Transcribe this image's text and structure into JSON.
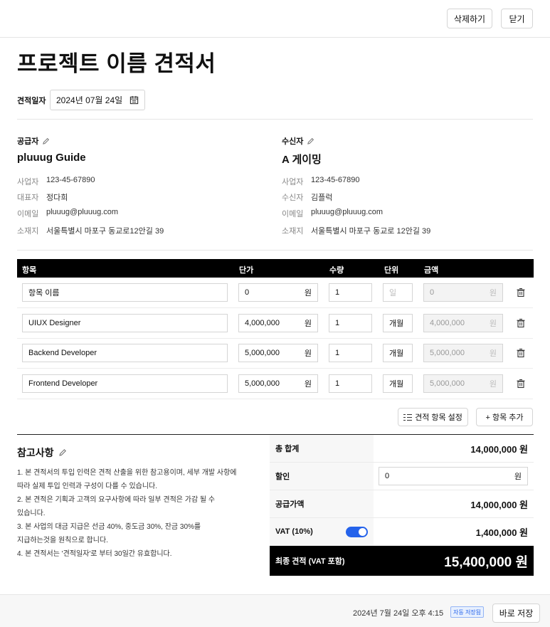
{
  "header": {
    "delete_label": "삭제하기",
    "close_label": "닫기"
  },
  "title": "프로젝트 이름 견적서",
  "date": {
    "label": "견적일자",
    "value": "2024년 07월 24일"
  },
  "supplier": {
    "heading": "공급자",
    "name": "pluuug Guide",
    "fields": [
      {
        "label": "사업자",
        "value": "123-45-67890"
      },
      {
        "label": "대표자",
        "value": "정다희"
      },
      {
        "label": "이메일",
        "value": "pluuug@pluuug.com"
      },
      {
        "label": "소재지",
        "value": "서울특별시 마포구 동교로12안길 39"
      }
    ]
  },
  "recipient": {
    "heading": "수신자",
    "name": "A 게이밍",
    "fields": [
      {
        "label": "사업자",
        "value": "123-45-67890"
      },
      {
        "label": "수신자",
        "value": "김플럭"
      },
      {
        "label": "이메일",
        "value": "pluuug@pluuug.com"
      },
      {
        "label": "소재지",
        "value": "서울특별시 마포구 동교로 12안길 39"
      }
    ]
  },
  "table": {
    "headers": {
      "item": "항목",
      "price": "단가",
      "qty": "수량",
      "unit": "단위",
      "amount": "금액"
    },
    "currency": "원",
    "rows": [
      {
        "item": "항목 이름",
        "price": "0",
        "qty": "1",
        "unit": "일",
        "amount": "0",
        "placeholder": true
      },
      {
        "item": "UIUX Designer",
        "price": "4,000,000",
        "qty": "1",
        "unit": "개월",
        "amount": "4,000,000",
        "placeholder": false
      },
      {
        "item": "Backend Developer",
        "price": "5,000,000",
        "qty": "1",
        "unit": "개월",
        "amount": "5,000,000",
        "placeholder": false
      },
      {
        "item": "Frontend Developer",
        "price": "5,000,000",
        "qty": "1",
        "unit": "개월",
        "amount": "5,000,000",
        "placeholder": false
      }
    ],
    "settings_label": "견적 항목 설정",
    "add_label": "+ 항목 추가"
  },
  "notes": {
    "heading": "참고사항",
    "lines": [
      "1. 본 견적서의 투입 인력은 견적 산출을 위한 참고용이며, 세부 개발 사항에",
      "따라 실제 투입 인력과 구성이 다를 수 있습니다.",
      "2. 본 견적은 기획과 고객의 요구사항에 따라 일부 견적은 가감 될 수",
      "있습니다.",
      "3. 본 사업의 대금 지급은 선금 40%, 중도금 30%, 잔금 30%를",
      "지급하는것을 원칙으로 합니다.",
      "4. 본 견적서는 '견적일자'로 부터 30일간 유효합니다."
    ]
  },
  "summary": {
    "total_label": "총 합계",
    "total_value": "14,000,000 원",
    "discount_label": "할인",
    "discount_value": "0",
    "discount_unit": "원",
    "supply_label": "공급가액",
    "supply_value": "14,000,000 원",
    "vat_label": "VAT (10%)",
    "vat_enabled": true,
    "vat_value": "1,400,000 원",
    "final_label": "최종 견적 (VAT 포함)",
    "final_value": "15,400,000 원"
  },
  "footer": {
    "timestamp": "2024년 7월 24일 오후 4:15",
    "autosave_badge": "자동 저장됨",
    "save_label": "바로 저장"
  },
  "colors": {
    "accent": "#2563eb",
    "header_bg": "#000000",
    "footer_bg": "#f7f7f7"
  }
}
